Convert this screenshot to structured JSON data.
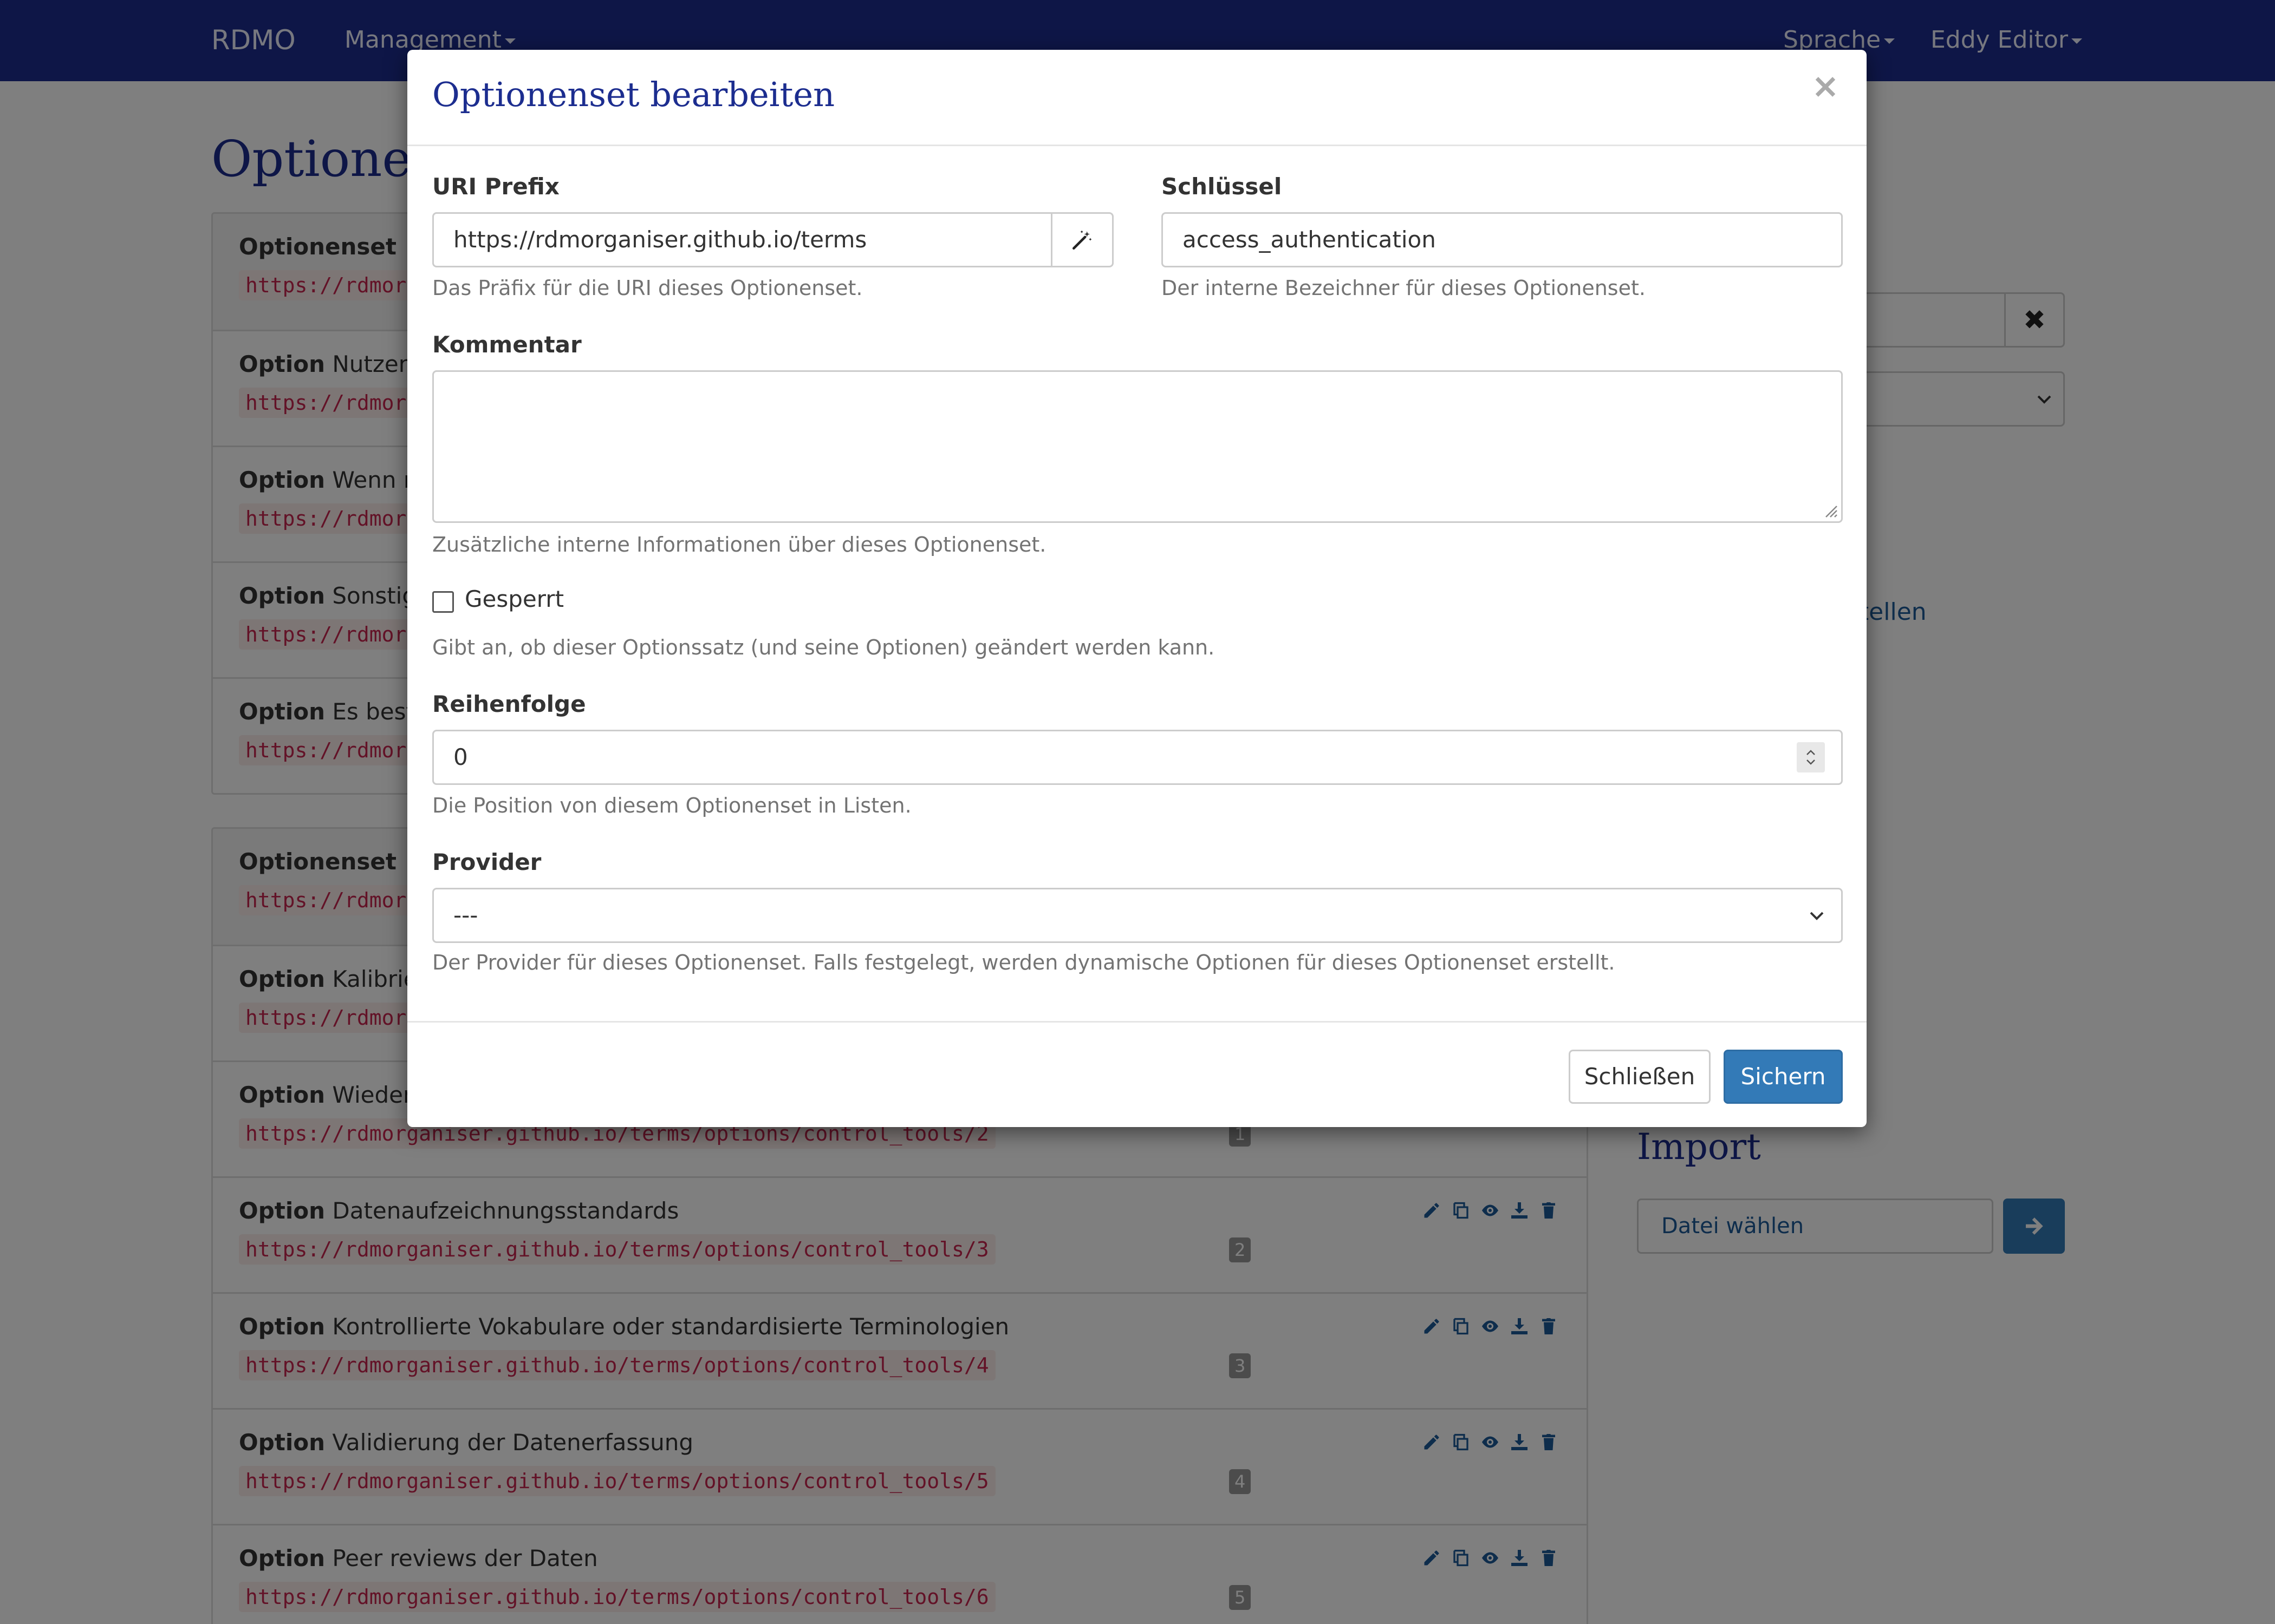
{
  "navbar": {
    "brand": "RDMO",
    "management": "Management",
    "language": "Sprache",
    "user": "Eddy Editor"
  },
  "page": {
    "title": "Optionen"
  },
  "panel1": {
    "rows": [
      {
        "type": "Optionenset",
        "text": "",
        "uri": "https://rdmor"
      },
      {
        "type": "Option",
        "text": "Nutzende",
        "uri": "https://rdmor"
      },
      {
        "type": "Option",
        "text": "Wenn no",
        "uri": "https://rdmor"
      },
      {
        "type": "Option",
        "text": "Sonstiges",
        "uri": "https://rdmor"
      },
      {
        "type": "Option",
        "text": "Es besteh",
        "uri": "https://rdmor"
      }
    ]
  },
  "panel2": {
    "rows": [
      {
        "type": "Optionenset",
        "text": "",
        "uri": "https://rdmor",
        "badge": ""
      },
      {
        "type": "Option",
        "text": "Kalibrier",
        "uri": "https://rdmor",
        "badge": ""
      },
      {
        "type": "Option",
        "text": "Wiederhe",
        "uri": "https://rdmorganiser.github.io/terms/options/control_tools/2",
        "badge": "1"
      },
      {
        "type": "Option",
        "text": "Datenaufzeichnungsstandards",
        "uri": "https://rdmorganiser.github.io/terms/options/control_tools/3",
        "badge": "2"
      },
      {
        "type": "Option",
        "text": "Kontrollierte Vokabulare oder standardisierte Terminologien",
        "uri": "https://rdmorganiser.github.io/terms/options/control_tools/4",
        "badge": "3"
      },
      {
        "type": "Option",
        "text": "Validierung der Datenerfassung",
        "uri": "https://rdmorganiser.github.io/terms/options/control_tools/5",
        "badge": "4"
      },
      {
        "type": "Option",
        "text": "Peer reviews der Daten",
        "uri": "https://rdmorganiser.github.io/terms/options/control_tools/6",
        "badge": "5"
      }
    ]
  },
  "sidebar": {
    "link_fragment": "stellen",
    "import_title": "Import",
    "file_button": "Datei wählen"
  },
  "modal": {
    "title": "Optionenset bearbeiten",
    "close_symbol": "×",
    "uri_prefix": {
      "label": "URI Prefix",
      "value": "https://rdmorganiser.github.io/terms",
      "help": "Das Präfix für die URI dieses Optionenset."
    },
    "key": {
      "label": "Schlüssel",
      "value": "access_authentication",
      "help": "Der interne Bezeichner für dieses Optionenset."
    },
    "comment": {
      "label": "Kommentar",
      "value": "",
      "help": "Zusätzliche interne Informationen über dieses Optionenset."
    },
    "locked": {
      "label": "Gesperrt",
      "checked": false,
      "help": "Gibt an, ob dieser Optionssatz (und seine Optionen) geändert werden kann."
    },
    "order": {
      "label": "Reihenfolge",
      "value": "0",
      "help": "Die Position von diesem Optionenset in Listen."
    },
    "provider": {
      "label": "Provider",
      "value": "---",
      "help": "Der Provider für dieses Optionenset. Falls festgelegt, werden dynamische Optionen für dieses Optionenset erstellt."
    },
    "buttons": {
      "close": "Schließen",
      "save": "Sichern"
    }
  },
  "colors": {
    "navbar": "#1c2d8f",
    "primary": "#337ab7",
    "title": "#1c2d8f",
    "uri_text": "#c7254e"
  }
}
